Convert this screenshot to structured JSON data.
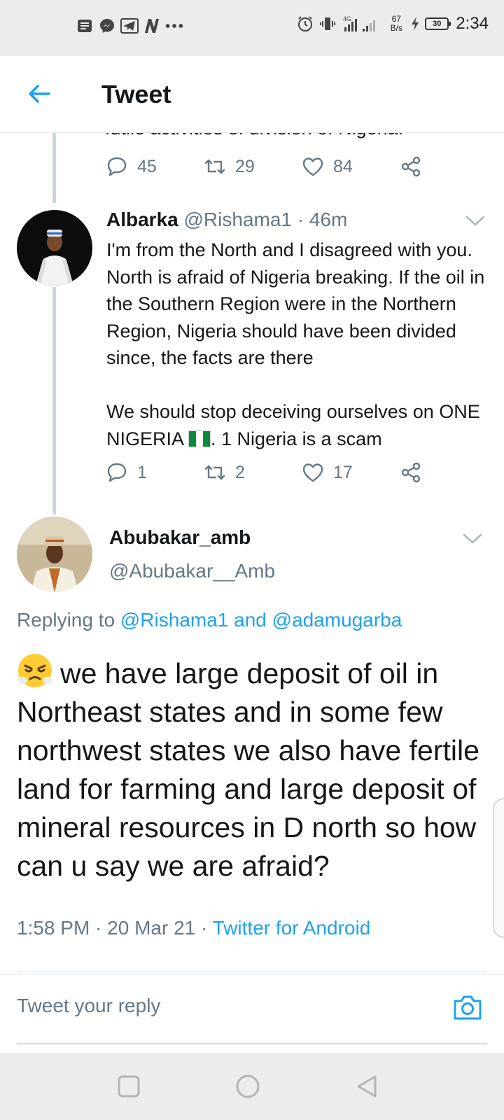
{
  "status_bar": {
    "net_type": "4G",
    "speed_value": "67",
    "speed_unit": "B/s",
    "battery": "30",
    "time": "2:34",
    "icons": [
      "notes-icon",
      "messenger-icon",
      "telegram-icon",
      "n-app-icon",
      "more-dots-icon",
      "alarm-icon",
      "vibrate-icon",
      "signal-icon",
      "charging-icon",
      "battery-icon"
    ]
  },
  "header": {
    "title": "Tweet"
  },
  "previous_tweet": {
    "cut_text": "futile activities of division of Nigeria.",
    "replies": "45",
    "retweets": "29",
    "likes": "84"
  },
  "reply_tweet": {
    "name": "Albarka",
    "handle": "@Rishama1",
    "time": "· 46m",
    "body_p1": "I'm from the North and I disagreed with you. North is afraid of Nigeria breaking. If the oil in the Southern Region were in the Northern Region, Nigeria should have been divided since, the facts are there",
    "body_p2a": "We should stop deceiving ourselves on ONE NIGERIA ",
    "body_p2b": ". 1 Nigeria is a scam",
    "replies": "1",
    "retweets": "2",
    "likes": "17"
  },
  "main_tweet": {
    "name": "Abubakar_amb",
    "handle": "@Abubakar__Amb",
    "replying_prefix": "Replying to ",
    "replying_user1": "@Rishama1",
    "replying_and": " and ",
    "replying_user2": "@adamugarba",
    "body": "we have large deposit of oil in Northeast states and in some few northwest states we also have fertile land for farming and large deposit of mineral resources in D north so how can u say we are afraid?",
    "time": "1:58 PM",
    "date": "20 Mar 21",
    "app": "Twitter for Android"
  },
  "reply_bar": {
    "placeholder": "Tweet your reply"
  },
  "colors": {
    "accent": "#1da1f2",
    "secondary_text": "#657786",
    "text": "#14171a"
  }
}
